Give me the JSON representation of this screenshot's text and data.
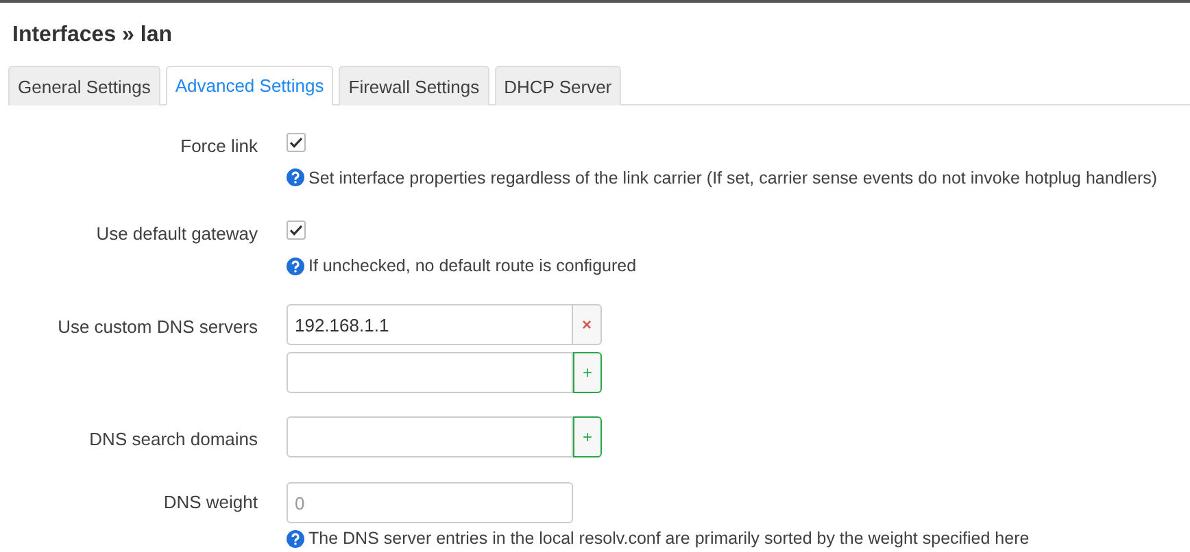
{
  "title": "Interfaces » lan",
  "tabs": [
    {
      "label": "General Settings",
      "selected": false
    },
    {
      "label": "Advanced Settings",
      "selected": true
    },
    {
      "label": "Firewall Settings",
      "selected": false
    },
    {
      "label": "DHCP Server",
      "selected": false
    }
  ],
  "fields": [
    {
      "kind": "checkbox",
      "label": "Force link",
      "checked": true,
      "help": "Set interface properties regardless of the link carrier (If set, carrier sense events do not invoke hotplug handlers)"
    },
    {
      "kind": "checkbox",
      "label": "Use default gateway",
      "checked": true,
      "help": "If unchecked, no default route is configured"
    },
    {
      "kind": "list",
      "label": "Use custom DNS servers",
      "entries": [
        {
          "value": "192.168.1.1",
          "button": "×"
        },
        {
          "button": "+"
        }
      ]
    },
    {
      "kind": "list",
      "label": "DNS search domains",
      "entries": [
        {
          "button": "+"
        }
      ]
    },
    {
      "kind": "text",
      "label": "DNS weight",
      "placeholder": "0",
      "help": "The DNS server entries in the local resolv.conf are primarily sorted by the weight specified here"
    }
  ]
}
